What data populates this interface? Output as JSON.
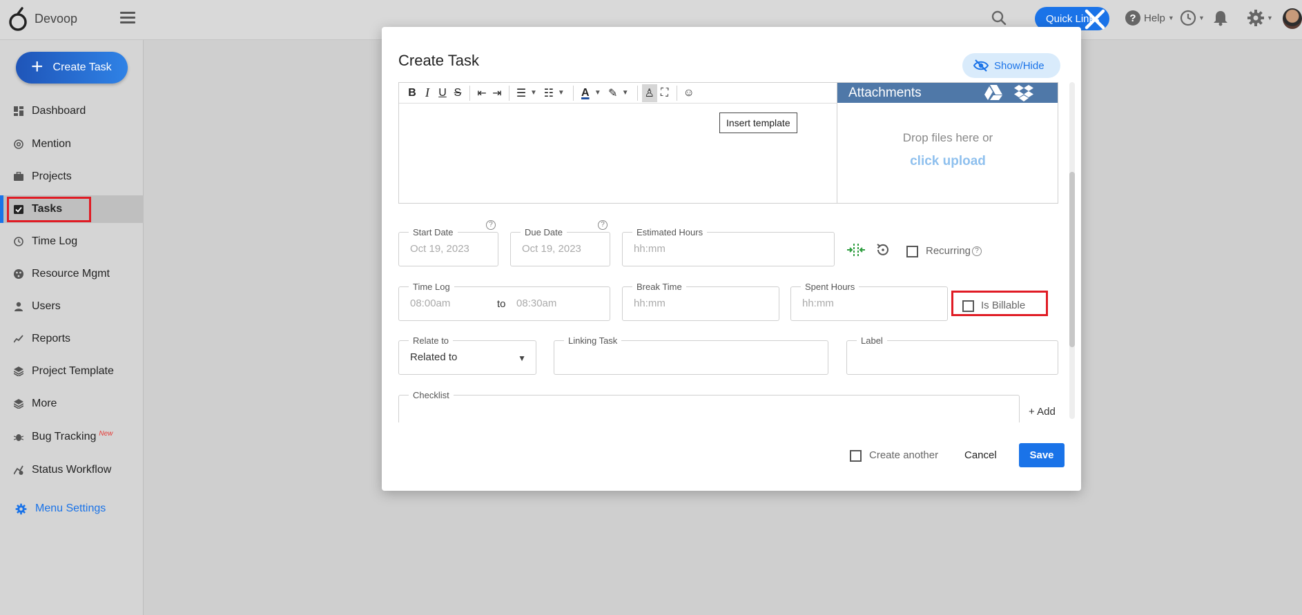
{
  "app": {
    "brand": "Devoop"
  },
  "topbar": {
    "quick_links": "Quick Links",
    "help": "Help"
  },
  "sidebar": {
    "create_task": "Create Task",
    "items": [
      {
        "label": "Dashboard",
        "icon": "dashboard-icon"
      },
      {
        "label": "Mention",
        "icon": "at-icon"
      },
      {
        "label": "Projects",
        "icon": "briefcase-icon"
      },
      {
        "label": "Tasks",
        "icon": "task-icon",
        "active": true
      },
      {
        "label": "Time Log",
        "icon": "clock-icon"
      },
      {
        "label": "Resource Mgmt",
        "icon": "resource-icon"
      },
      {
        "label": "Users",
        "icon": "user-icon"
      },
      {
        "label": "Reports",
        "icon": "chart-icon"
      },
      {
        "label": "Project Template",
        "icon": "layers-icon"
      },
      {
        "label": "More",
        "icon": "layers-icon"
      },
      {
        "label": "Bug Tracking",
        "icon": "bug-icon",
        "badge": "New"
      },
      {
        "label": "Status Workflow",
        "icon": "workflow-icon"
      }
    ],
    "menu_settings": "Menu Settings"
  },
  "modal": {
    "title": "Create Task",
    "show_hide": "Show/Hide",
    "editor": {
      "tooltip": "Insert template"
    },
    "attachments": {
      "title": "Attachments",
      "drop_text": "Drop files here or",
      "upload_link": "click upload"
    },
    "fields": {
      "start_date": {
        "label": "Start Date",
        "value": "Oct 19, 2023"
      },
      "due_date": {
        "label": "Due Date",
        "value": "Oct 19, 2023"
      },
      "estimated_hours": {
        "label": "Estimated Hours",
        "placeholder": "hh:mm"
      },
      "recurring": "Recurring",
      "time_log": {
        "label": "Time Log",
        "from": "08:00am",
        "to_text": "to",
        "to": "08:30am"
      },
      "break_time": {
        "label": "Break Time",
        "placeholder": "hh:mm"
      },
      "spent_hours": {
        "label": "Spent Hours",
        "placeholder": "hh:mm"
      },
      "is_billable": "Is Billable",
      "relate_to": {
        "label": "Relate to",
        "value": "Related to"
      },
      "linking_task": {
        "label": "Linking Task"
      },
      "label_field": {
        "label": "Label"
      },
      "checklist": {
        "label": "Checklist",
        "add": "+ Add"
      }
    },
    "footer": {
      "create_another": "Create another",
      "cancel": "Cancel",
      "save": "Save"
    }
  },
  "colors": {
    "primary": "#1a73e8",
    "attachments_header": "#4f78a8",
    "highlight": "#e01b24"
  }
}
